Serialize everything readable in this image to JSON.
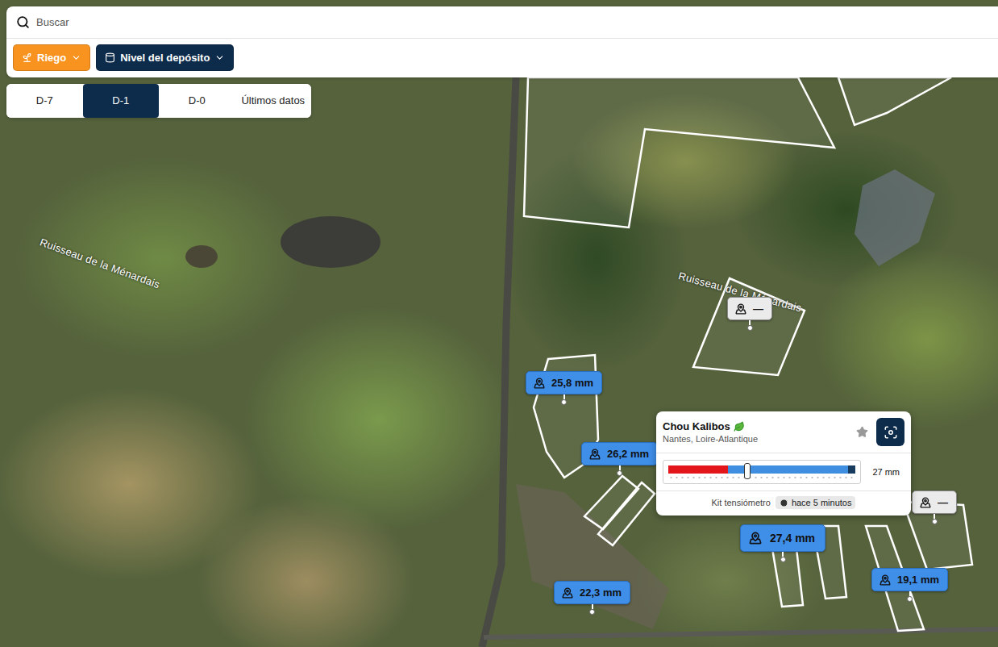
{
  "search": {
    "placeholder": "Buscar"
  },
  "filters": [
    {
      "label": "Riego",
      "color": "#f7931e"
    },
    {
      "label": "Nivel del depósito",
      "color": "#0d2b4a"
    }
  ],
  "tabs": [
    {
      "label": "D-7",
      "selected": false
    },
    {
      "label": "D-1",
      "selected": true
    },
    {
      "label": "D-0",
      "selected": false
    },
    {
      "label": "Últimos datos",
      "selected": false
    }
  ],
  "map_labels": [
    "Ruisseau de la Ménardais",
    "Ruisseau de la Ménardais"
  ],
  "pins": [
    {
      "label": "—",
      "kind": "empty",
      "selected": false
    },
    {
      "label": "25,8 mm",
      "kind": "value",
      "selected": false
    },
    {
      "label": "26,2 mm",
      "kind": "value",
      "selected": false
    },
    {
      "label": "22,3 mm",
      "kind": "value",
      "selected": false
    },
    {
      "label": "—",
      "kind": "empty",
      "selected": false
    },
    {
      "label": "19,1 mm",
      "kind": "value",
      "selected": false
    },
    {
      "label": "27,4 mm",
      "kind": "value",
      "selected": true
    }
  ],
  "popup": {
    "title": "Chou Kalibos",
    "location": "Nantes, Loire-Atlantique",
    "favorite": false,
    "gauge": {
      "level": 0.42,
      "reading": "27 mm",
      "zones": [
        {
          "color": "#e3161b",
          "level": 0.32
        },
        {
          "color": "#3f8ee0",
          "level": 0.96
        },
        {
          "color": "#173b5e",
          "level": 1
        }
      ]
    },
    "source": "Kit tensiómetro",
    "time": "hace 5 minutos"
  }
}
